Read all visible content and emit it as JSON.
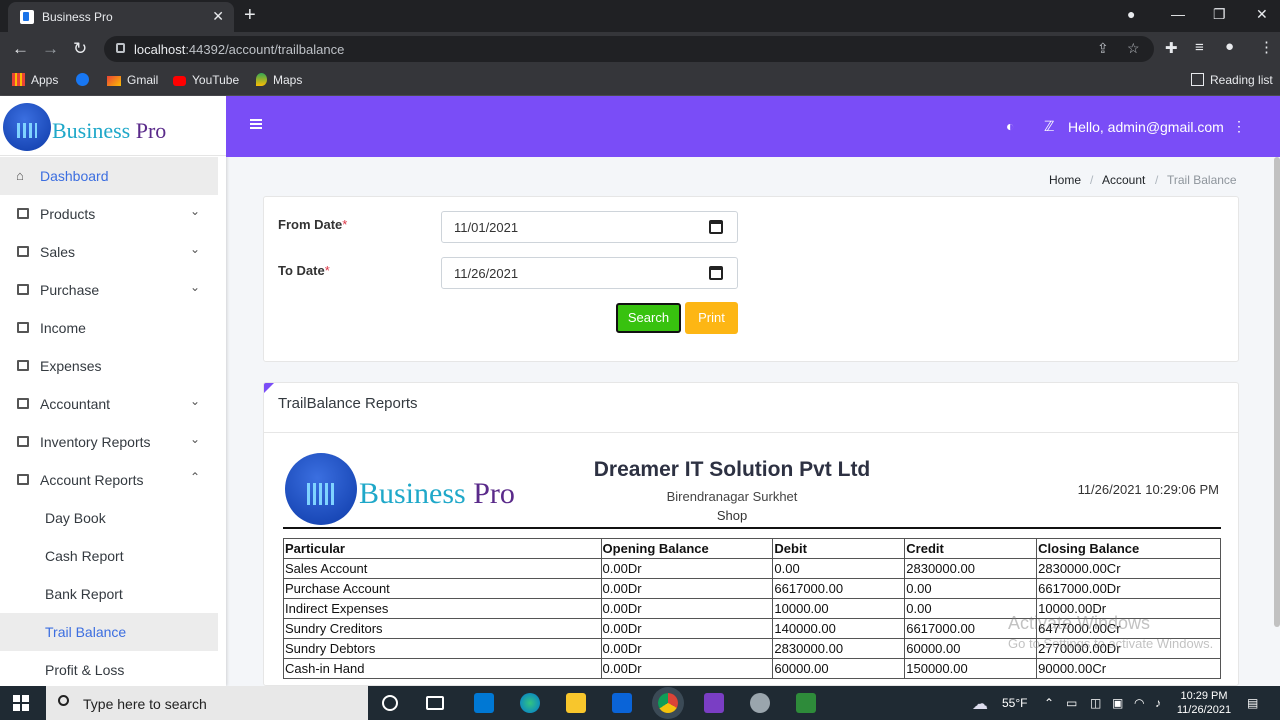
{
  "browser": {
    "tab_title": "Business Pro",
    "url_host": "localhost",
    "url_rest": ":44392/account/trailbalance",
    "bookmarks": [
      "Apps",
      "Gmail",
      "YouTube",
      "Maps"
    ],
    "reading_list": "Reading list"
  },
  "brand": {
    "part1": "Business",
    "part2": " Pro"
  },
  "sidebar": {
    "items": [
      {
        "label": "Dashboard"
      },
      {
        "label": "Products"
      },
      {
        "label": "Sales"
      },
      {
        "label": "Purchase"
      },
      {
        "label": "Income"
      },
      {
        "label": "Expenses"
      },
      {
        "label": "Accountant"
      },
      {
        "label": "Inventory Reports"
      },
      {
        "label": "Account Reports"
      },
      {
        "label": "Day Book"
      },
      {
        "label": "Cash Report"
      },
      {
        "label": "Bank Report"
      },
      {
        "label": "Trail Balance"
      },
      {
        "label": "Profit & Loss"
      }
    ]
  },
  "header": {
    "greeting": "Hello, admin@gmail.com"
  },
  "breadcrumb": {
    "home": "Home",
    "account": "Account",
    "current": "Trail Balance"
  },
  "filter": {
    "from_label": "From Date",
    "from_value": "11/01/2021",
    "to_label": "To Date",
    "to_value": "11/26/2021",
    "required_mark": "*",
    "search_label": "Search",
    "print_label": "Print"
  },
  "report": {
    "card_title": "TrailBalance Reports",
    "company": "Dreamer IT Solution Pvt Ltd",
    "address1": "Birendranagar Surkhet",
    "address2": "Shop",
    "timestamp": "11/26/2021 10:29:06 PM",
    "columns": [
      "Particular",
      "Opening Balance",
      "Debit",
      "Credit",
      "Closing Balance"
    ],
    "rows": [
      [
        "Sales Account",
        "0.00Dr",
        "0.00",
        "2830000.00",
        "2830000.00Cr"
      ],
      [
        "Purchase Account",
        "0.00Dr",
        "6617000.00",
        "0.00",
        "6617000.00Dr"
      ],
      [
        "Indirect Expenses",
        "0.00Dr",
        "10000.00",
        "0.00",
        "10000.00Dr"
      ],
      [
        "Sundry Creditors",
        "0.00Dr",
        "140000.00",
        "6617000.00",
        "6477000.00Cr"
      ],
      [
        "Sundry Debtors",
        "0.00Dr",
        "2830000.00",
        "60000.00",
        "2770000.00Dr"
      ],
      [
        "Cash-in Hand",
        "0.00Dr",
        "60000.00",
        "150000.00",
        "90000.00Cr"
      ]
    ]
  },
  "watermark": {
    "line1": "Activate Windows",
    "line2": "Go to Settings to activate Windows."
  },
  "taskbar": {
    "search_placeholder": "Type here to search",
    "weather": "55°F",
    "time": "10:29 PM",
    "date": "11/26/2021"
  }
}
